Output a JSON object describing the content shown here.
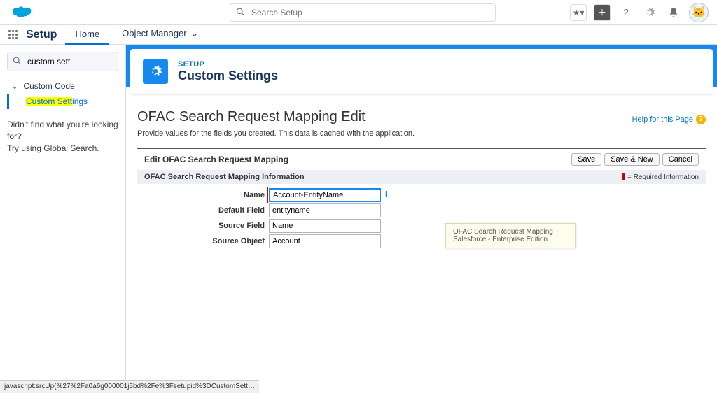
{
  "header": {
    "search_placeholder": "Search Setup",
    "star_label": "★",
    "avatar_emoji": "🐱"
  },
  "nav": {
    "setup": "Setup",
    "home": "Home",
    "object_manager": "Object Manager"
  },
  "sidebar": {
    "search_value": "custom sett",
    "tree_parent": "Custom Code",
    "tree_leaf_hl": "Custom Sett",
    "tree_leaf_rest": "ings",
    "tip1": "Didn't find what you're looking for?",
    "tip2": "Try using Global Search."
  },
  "page_header": {
    "eyebrow": "SETUP",
    "title": "Custom Settings"
  },
  "content": {
    "heading": "OFAC Search Request Mapping Edit",
    "help_link": "Help for this Page",
    "description": "Provide values for the fields you created. This data is cached with the application.",
    "edit_title": "Edit OFAC Search Request Mapping",
    "buttons": {
      "save": "Save",
      "save_new": "Save & New",
      "cancel": "Cancel"
    },
    "section_title": "OFAC Search Request Mapping Information",
    "required_note": "= Required Information",
    "fields": {
      "name": {
        "label": "Name",
        "value": "Account-EntityName"
      },
      "default_field": {
        "label": "Default Field",
        "value": "entityname"
      },
      "source_field": {
        "label": "Source Field",
        "value": "Name"
      },
      "source_object": {
        "label": "Source Object",
        "value": "Account"
      }
    }
  },
  "tooltip": "OFAC Search Request Mapping ~ Salesforce - Enterprise Edition",
  "status_bar": "javascript:srcUp(%27%2Fa0a6g000001j5bd%2Fe%3Fsetupid%3DCustomSetting..."
}
